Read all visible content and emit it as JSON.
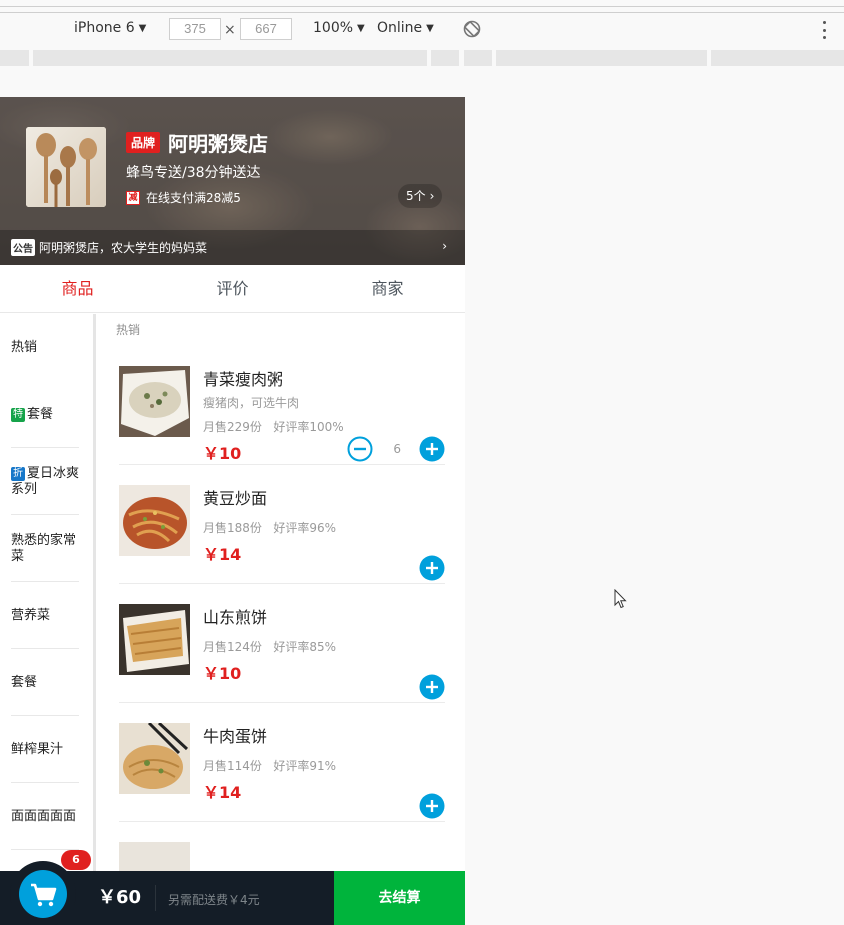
{
  "devtools": {
    "device": "iPhone 6",
    "width": "375",
    "height": "667",
    "zoom": "100%",
    "network": "Online"
  },
  "header": {
    "brand_badge": "品牌",
    "shop_name": "阿明粥煲店",
    "delivery": "蜂鸟专送/38分钟送达",
    "promo_icon": "减",
    "promo_text": "在线支付满28减5",
    "promo_count": "5个",
    "notice_tag": "公告",
    "notice_text": "阿明粥煲店，农大学生的妈妈菜"
  },
  "tabs": [
    {
      "label": "商品",
      "active": true
    },
    {
      "label": "评价",
      "active": false
    },
    {
      "label": "商家",
      "active": false
    }
  ],
  "menu": [
    {
      "label": "热销",
      "badge": ""
    },
    {
      "label": "套餐",
      "badge": "特"
    },
    {
      "label": "夏日冰爽系列",
      "badge": "折"
    },
    {
      "label": "熟悉的家常菜",
      "badge": ""
    },
    {
      "label": "营养菜",
      "badge": ""
    },
    {
      "label": "套餐",
      "badge": ""
    },
    {
      "label": "鲜榨果汁",
      "badge": ""
    },
    {
      "label": "面面面面面",
      "badge": ""
    },
    {
      "label": "",
      "badge": ""
    }
  ],
  "section_title": "热销",
  "foods": [
    {
      "name": "青菜瘦肉粥",
      "desc": "瘦猪肉，可选牛肉",
      "sold": "月售229份",
      "rating": "好评率100%",
      "price": "￥10",
      "count": "6"
    },
    {
      "name": "黄豆炒面",
      "desc": "",
      "sold": "月售188份",
      "rating": "好评率96%",
      "price": "￥14",
      "count": ""
    },
    {
      "name": "山东煎饼",
      "desc": "",
      "sold": "月售124份",
      "rating": "好评率85%",
      "price": "￥10",
      "count": ""
    },
    {
      "name": "牛肉蛋饼",
      "desc": "",
      "sold": "月售114份",
      "rating": "好评率91%",
      "price": "￥14",
      "count": ""
    }
  ],
  "cart": {
    "badge": "6",
    "price": "￥60",
    "desc": "另需配送费￥4元",
    "checkout": "去结算"
  },
  "colors": {
    "accent_red": "#e0201f",
    "accent_blue": "#00a0dc",
    "checkout_green": "#00b43c",
    "cart_bg": "#141d27"
  }
}
